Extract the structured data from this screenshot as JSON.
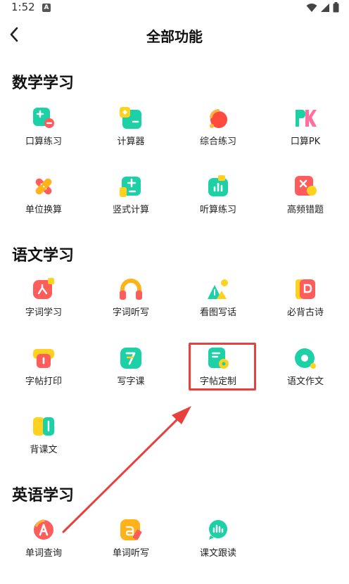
{
  "status_bar": {
    "time": "1:52",
    "notification_badge": "A",
    "icons": [
      "wifi-icon",
      "signal-icon",
      "battery-icon"
    ]
  },
  "header": {
    "title": "全部功能",
    "back_icon": "chevron-left-icon"
  },
  "sections": [
    {
      "title": "数学学习",
      "items": [
        {
          "label": "口算练习",
          "icon": "oral-calc-icon"
        },
        {
          "label": "计算器",
          "icon": "calculator-icon"
        },
        {
          "label": "综合练习",
          "icon": "comprehensive-practice-icon"
        },
        {
          "label": "口算PK",
          "icon": "pk-icon"
        },
        {
          "label": "单位换算",
          "icon": "unit-convert-icon"
        },
        {
          "label": "竖式计算",
          "icon": "vertical-calc-icon"
        },
        {
          "label": "听算练习",
          "icon": "listen-calc-icon"
        },
        {
          "label": "高频错题",
          "icon": "frequent-mistakes-icon"
        }
      ]
    },
    {
      "title": "语文学习",
      "items": [
        {
          "label": "字词学习",
          "icon": "word-study-icon"
        },
        {
          "label": "字词听写",
          "icon": "headphone-icon"
        },
        {
          "label": "看图写话",
          "icon": "picture-writing-icon"
        },
        {
          "label": "必背古诗",
          "icon": "poem-book-icon"
        },
        {
          "label": "字帖打印",
          "icon": "printer-icon"
        },
        {
          "label": "写字课",
          "icon": "writing-class-icon"
        },
        {
          "label": "字帖定制",
          "icon": "copybook-custom-icon"
        },
        {
          "label": "语文作文",
          "icon": "composition-icon"
        },
        {
          "label": "背课文",
          "icon": "recite-text-icon"
        }
      ]
    },
    {
      "title": "英语学习",
      "items": [
        {
          "label": "单词查询",
          "icon": "word-lookup-icon"
        },
        {
          "label": "单词听写",
          "icon": "word-dictation-icon"
        },
        {
          "label": "课文跟读",
          "icon": "follow-reading-icon"
        }
      ]
    }
  ],
  "annotation": {
    "highlight_color": "#e8403c",
    "highlighted_item": "字帖定制"
  }
}
